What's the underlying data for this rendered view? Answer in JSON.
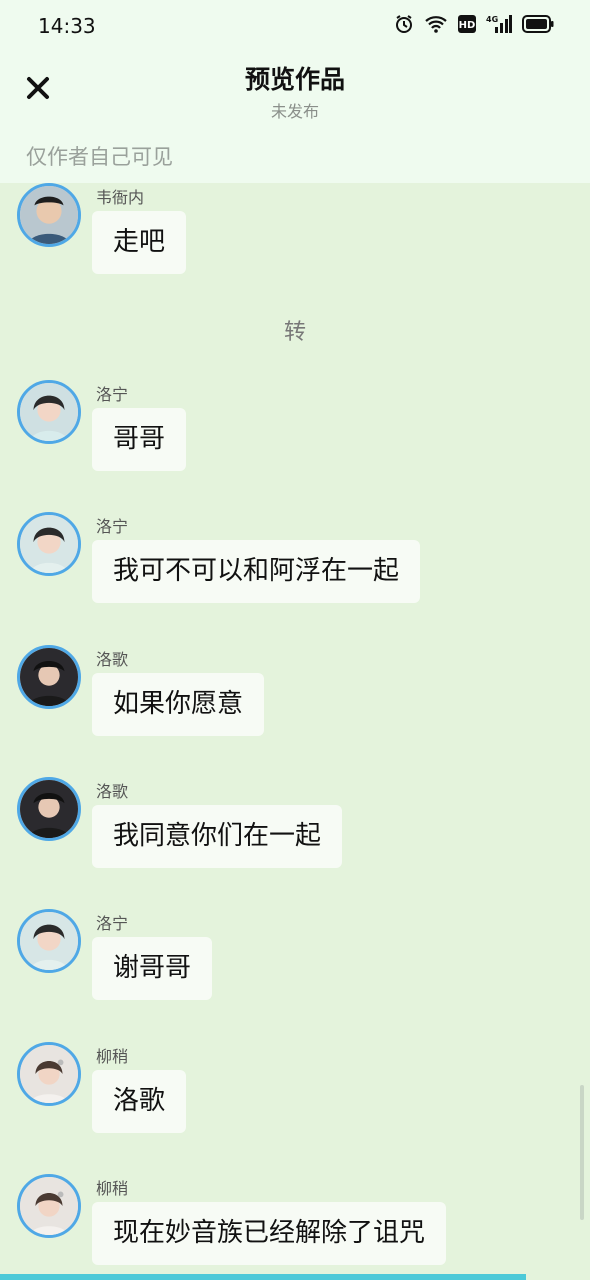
{
  "status": {
    "time": "14:33"
  },
  "header": {
    "title": "预览作品",
    "subtitle": "未发布",
    "visibility_note": "仅作者自己可见",
    "close_icon": "close-icon"
  },
  "transition_text": "转",
  "messages": [
    {
      "name": "韦衙内",
      "text": "走吧",
      "avatar": "avatar-weiyanei"
    },
    {
      "name": "洛宁",
      "text": "哥哥",
      "avatar": "avatar-luoning"
    },
    {
      "name": "洛宁",
      "text": "我可不可以和阿浮在一起",
      "avatar": "avatar-luoning"
    },
    {
      "name": "洛歌",
      "text": "如果你愿意",
      "avatar": "avatar-luoge"
    },
    {
      "name": "洛歌",
      "text": "我同意你们在一起",
      "avatar": "avatar-luoge"
    },
    {
      "name": "洛宁",
      "text": "谢哥哥",
      "avatar": "avatar-luoning"
    },
    {
      "name": "柳稍",
      "text": "洛歌",
      "avatar": "avatar-liushao"
    },
    {
      "name": "柳稍",
      "text": "现在妙音族已经解除了诅咒",
      "avatar": "avatar-liushao"
    }
  ],
  "colors": {
    "background": "#e4f3dc",
    "header": "#effbef",
    "avatar_ring": "#4fa8e6",
    "bubble": "#f7fbf5",
    "bottom_bar": "#4cc9d8"
  }
}
